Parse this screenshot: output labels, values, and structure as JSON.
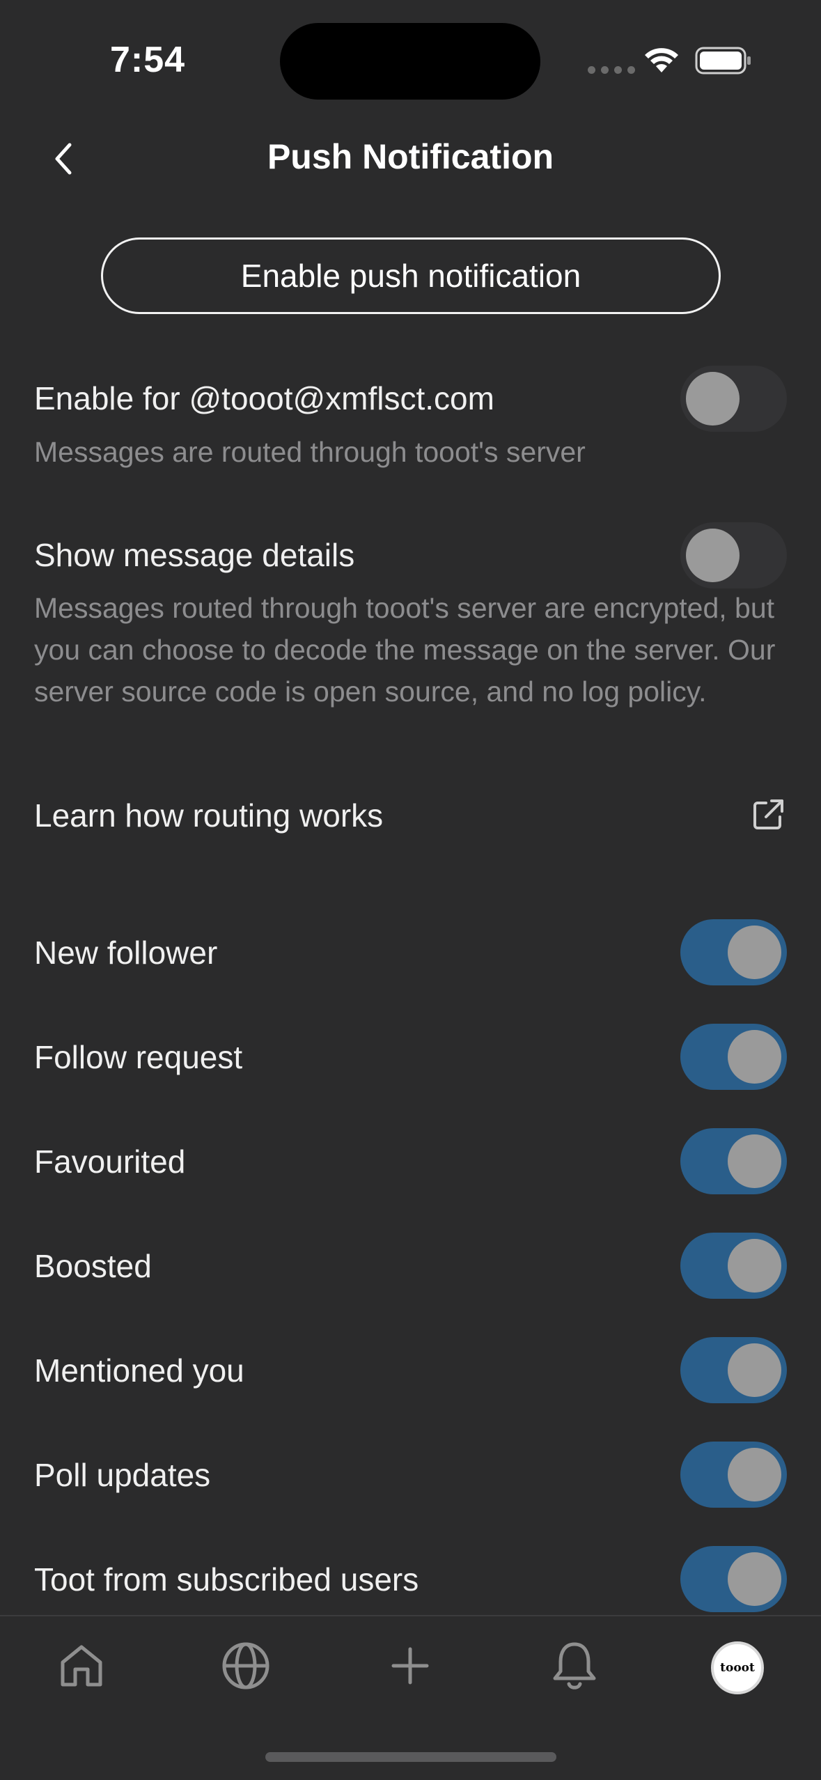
{
  "status_bar": {
    "time": "7:54"
  },
  "header": {
    "title": "Push Notification"
  },
  "enable_button": {
    "label": "Enable push notification"
  },
  "account_setting": {
    "label": "Enable for @tooot@xmflsct.com",
    "description": "Messages are routed through tooot's server",
    "enabled": false
  },
  "message_details": {
    "label": "Show message details",
    "description": "Messages routed through tooot's server are encrypted, but you can choose to decode the message on the server. Our server source code is open source, and no log policy.",
    "enabled": false
  },
  "learn_link": {
    "label": "Learn how routing works"
  },
  "notification_types": [
    {
      "label": "New follower",
      "enabled": true
    },
    {
      "label": "Follow request",
      "enabled": true
    },
    {
      "label": "Favourited",
      "enabled": true
    },
    {
      "label": "Boosted",
      "enabled": true
    },
    {
      "label": "Mentioned you",
      "enabled": true
    },
    {
      "label": "Poll updates",
      "enabled": true
    },
    {
      "label": "Toot from subscribed users",
      "enabled": true
    }
  ],
  "tab_bar": {
    "tabs": [
      {
        "icon": "home-icon"
      },
      {
        "icon": "globe-icon"
      },
      {
        "icon": "plus-icon"
      },
      {
        "icon": "bell-icon"
      },
      {
        "icon": "profile-avatar",
        "avatar_text": "tooot"
      }
    ]
  },
  "colors": {
    "background": "#2b2b2c",
    "toggle_on": "#2a5e8a",
    "toggle_off": "#333335",
    "knob": "#9a9a9a"
  }
}
